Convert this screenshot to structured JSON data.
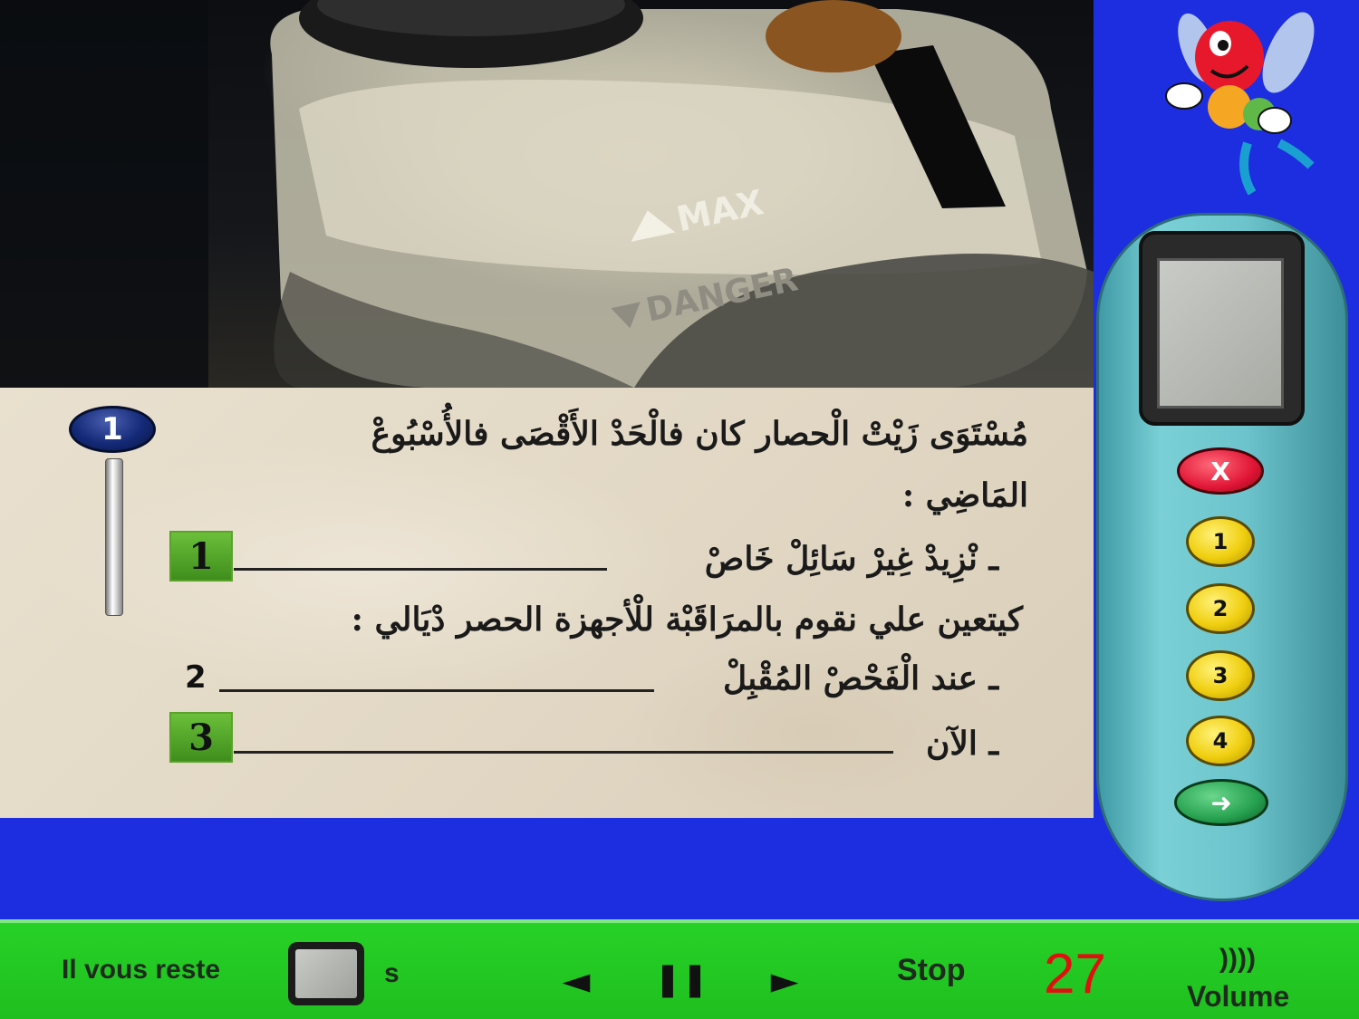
{
  "question": {
    "number": "1",
    "line1": "مُسْتَوَى زَيْتْ الْحصار كان فالْحَدْ الأَقْصَى فالأُسْبُوعْ",
    "line2": "المَاضِي :",
    "item1_text": "ـ نْزِيدْ غِيرْ سَائِلْ خَاصْ",
    "item1_slot": "1",
    "line3": "كيتعين علي نقوم  بالمرَاقَبْة للْأجهزة الحصر دْيَالي :",
    "item2_text": "ـ عند الْفَحْصْ المُقْبِلْ",
    "item2_label": "2",
    "item3_text": "ـ الآن",
    "item3_slot": "3"
  },
  "remote": {
    "cancel_label": "X",
    "btn1": "1",
    "btn2": "2",
    "btn3": "3",
    "btn4": "4",
    "next_label": "➜"
  },
  "bottom_bar": {
    "remaining_label": "Il vous reste",
    "seconds_unit": "s",
    "prev_label": "◄",
    "pause_label": "❚❚",
    "next_label": "►",
    "stop_label": "Stop",
    "counter": "27",
    "volume_icon": "))))",
    "volume_label": "Volume"
  },
  "colors": {
    "background_blue": "#1d2ee0",
    "bottom_green": "#22c722",
    "counter_red": "#e01010",
    "slot_green": "#4fa52a"
  }
}
